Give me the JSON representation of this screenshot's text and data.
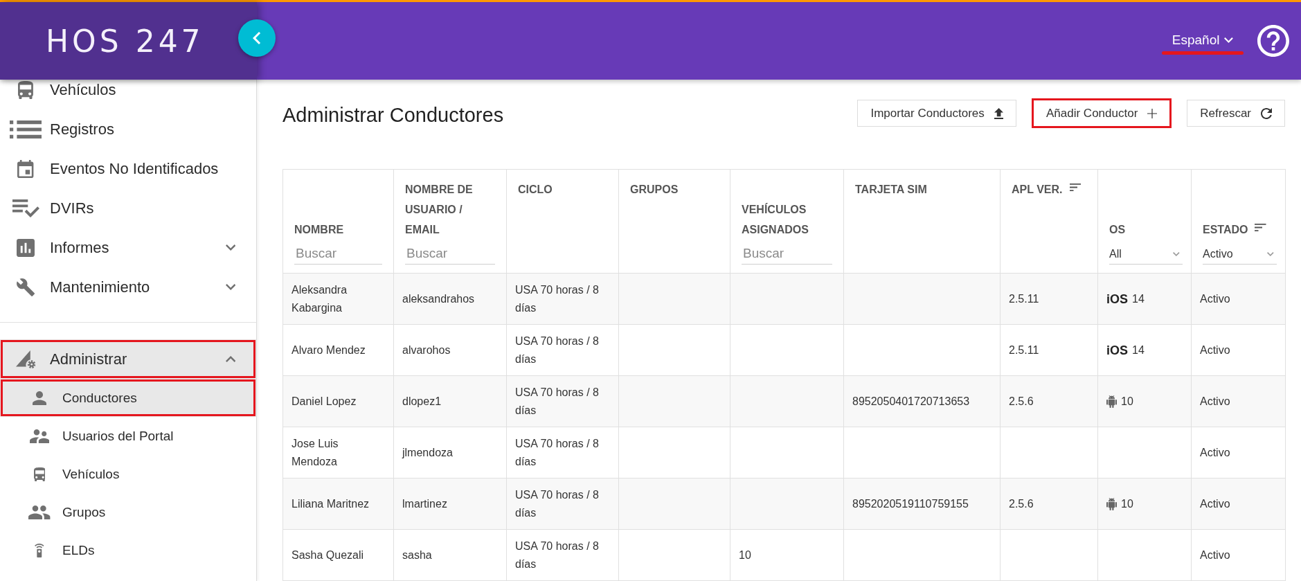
{
  "header": {
    "logo": "HOS 247",
    "language": {
      "label": "Español",
      "underlined": true
    }
  },
  "sidebar": {
    "groups": [
      {
        "items": [
          {
            "label": "Vehículos",
            "selected": false,
            "highlighted": false
          },
          {
            "label": "Registros",
            "selected": false,
            "highlighted": false
          },
          {
            "label": "Eventos No Identificados",
            "selected": false,
            "highlighted": false
          },
          {
            "label": "DVIRs",
            "selected": false,
            "highlighted": false
          },
          {
            "label": "Informes",
            "selected": false,
            "highlighted": false,
            "expanded": false
          },
          {
            "label": "Mantenimiento",
            "selected": false,
            "highlighted": false,
            "expanded": false
          }
        ]
      },
      {
        "items": [
          {
            "label": "Administrar",
            "selected": true,
            "highlighted": true,
            "expanded": true,
            "children": [
              {
                "label": "Conductores",
                "selected": true,
                "highlighted": true
              },
              {
                "label": "Usuarios del Portal",
                "selected": false,
                "highlighted": false
              },
              {
                "label": "Vehículos",
                "selected": false,
                "highlighted": false
              },
              {
                "label": "Grupos",
                "selected": false,
                "highlighted": false
              },
              {
                "label": "ELDs",
                "selected": false,
                "highlighted": false
              }
            ]
          }
        ]
      }
    ]
  },
  "page": {
    "title": "Administrar Conductores",
    "buttons": [
      {
        "label": "Importar Conductores",
        "highlighted": false
      },
      {
        "label": "Añadir Conductor",
        "highlighted": true
      },
      {
        "label": "Refrescar",
        "highlighted": false
      }
    ]
  },
  "table": {
    "columns": [
      {
        "label": "NOMBRE",
        "sortable": false,
        "filter": {
          "kind": "search",
          "placeholder": "Buscar"
        }
      },
      {
        "label": "NOMBRE DE USUARIO / EMAIL",
        "sortable": false,
        "filter": {
          "kind": "search",
          "placeholder": "Buscar"
        }
      },
      {
        "label": "CICLO",
        "sortable": false
      },
      {
        "label": "GRUPOS",
        "sortable": false
      },
      {
        "label": "VEHÍCULOS ASIGNADOS",
        "sortable": false,
        "filter": {
          "kind": "search",
          "placeholder": "Buscar"
        }
      },
      {
        "label": "TARJETA SIM",
        "sortable": false
      },
      {
        "label": "APL VER.",
        "sortable": true
      },
      {
        "label": "OS",
        "sortable": false,
        "filter": {
          "kind": "select",
          "value": "All"
        }
      },
      {
        "label": "ESTADO",
        "sortable": true,
        "filter": {
          "kind": "select",
          "value": "Activo"
        }
      }
    ],
    "rows": [
      {
        "name": "Aleksandra Kabargina",
        "user": "aleksandrahos",
        "cycle": "USA 70 horas / 8 días",
        "app_version": "2.5.11",
        "os": {
          "kind": "label",
          "label": "iOS",
          "version": "14"
        },
        "status": "Activo"
      },
      {
        "name": "Alvaro Mendez",
        "user": "alvarohos",
        "cycle": "USA 70 horas / 8 días",
        "app_version": "2.5.11",
        "os": {
          "kind": "label",
          "label": "iOS",
          "version": "14"
        },
        "status": "Activo"
      },
      {
        "name": "Daniel Lopez",
        "user": "dlopez1",
        "cycle": "USA 70 horas / 8 días",
        "sim": "8952050401720713653",
        "app_version": "2.5.6",
        "os": {
          "kind": "icon",
          "version": "10"
        },
        "status": "Activo"
      },
      {
        "name": "Jose Luis Mendoza",
        "user": "jlmendoza",
        "cycle": "USA 70 horas / 8 días",
        "status": "Activo"
      },
      {
        "name": "Liliana Maritnez",
        "user": "lmartinez",
        "cycle": "USA 70 horas / 8 días",
        "sim": "8952020519110759155",
        "app_version": "2.5.6",
        "os": {
          "kind": "icon",
          "version": "10"
        },
        "status": "Activo"
      },
      {
        "name": "Sasha Quezali",
        "user": "sasha",
        "cycle": "USA 70 horas / 8 días",
        "vehicles": "10",
        "status": "Activo"
      }
    ]
  }
}
